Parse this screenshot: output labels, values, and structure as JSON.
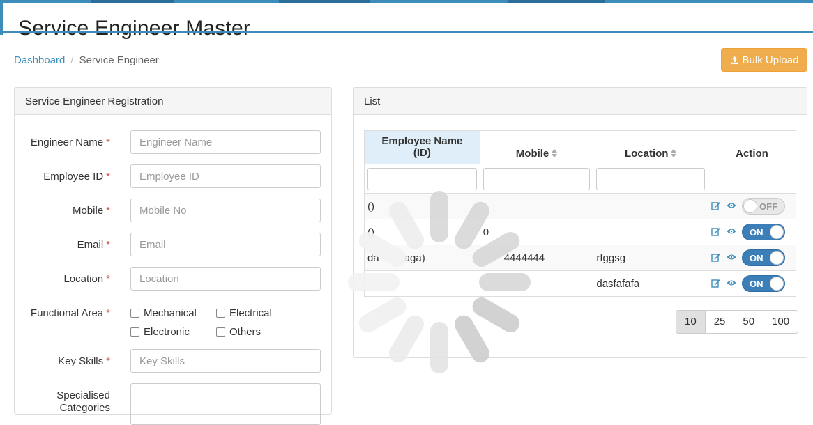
{
  "page": {
    "title": "Service Engineer Master",
    "breadcrumb": {
      "home": "Dashboard",
      "separator": "/",
      "current": "Service Engineer"
    },
    "bulk_upload_label": "Bulk Upload"
  },
  "form": {
    "heading": "Service Engineer Registration",
    "required_mark": "*",
    "fields": [
      {
        "label": "Engineer Name",
        "placeholder": "Engineer Name"
      },
      {
        "label": "Employee ID",
        "placeholder": "Employee ID"
      },
      {
        "label": "Mobile",
        "placeholder": "Mobile No"
      },
      {
        "label": "Email",
        "placeholder": "Email"
      },
      {
        "label": "Location",
        "placeholder": "Location"
      }
    ],
    "functional_area": {
      "label": "Functional Area",
      "options": [
        "Mechanical",
        "Electrical",
        "Electronic",
        "Others"
      ]
    },
    "key_skills": {
      "label": "Key Skills",
      "placeholder": "Key Skills"
    },
    "specialised": {
      "label_line1": "Specialised",
      "label_line2": "Categories"
    }
  },
  "list": {
    "heading": "List",
    "columns": [
      "Employee Name",
      "(ID)",
      "Mobile",
      "Location",
      "Action"
    ],
    "rows": [
      {
        "name": "()",
        "mobile": "",
        "location": "",
        "status": "OFF"
      },
      {
        "name": "()",
        "mobile": "0",
        "location": "",
        "status": "ON"
      },
      {
        "name": "da",
        "name_tail": "aga)",
        "mobile": "4444444",
        "location": "rfggsg",
        "status": "ON"
      },
      {
        "name": "",
        "mobile": "",
        "location": "dasfafafa",
        "status": "ON"
      }
    ],
    "page_sizes": [
      "10",
      "25",
      "50",
      "100"
    ],
    "active_page_size": "10"
  },
  "colors": {
    "primary": "#3c8dbc",
    "warning": "#f0ad4e",
    "toggle_on": "#3c7fb8",
    "required": "#d9534f"
  }
}
